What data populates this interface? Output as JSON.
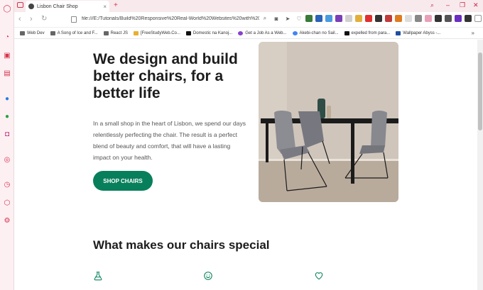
{
  "browser": {
    "tab_title": "Lisbon Chair Shop",
    "url": "file:///E:/Tutorials/Build%20Responsive%20Real-World%20Websites%20with%20HTML",
    "bookmarks": [
      "Web Dev",
      "A Song of Ice and F...",
      "React JS",
      "[FreeStudyWeb.Co...",
      "Domestic na Kanoj...",
      "Get a Job As a Web...",
      "Akebi-chan no Sail...",
      "expelled from para...",
      "Wallpaper Abyss -..."
    ],
    "accent_color": "#d6334f"
  },
  "page": {
    "hero_title": "We design and build better chairs, for a better life",
    "hero_text": "In a small shop in the heart of Lisbon, we spend our days relentlessly perfecting the chair. The result is a perfect blend of beauty and comfort, that will have a lasting impact on your health.",
    "cta_label": "SHOP CHAIRS",
    "brand_color": "#087f5b",
    "section_title": "What makes our chairs special",
    "feature_icons": [
      "flask-icon",
      "smile-icon",
      "heart-icon"
    ]
  }
}
